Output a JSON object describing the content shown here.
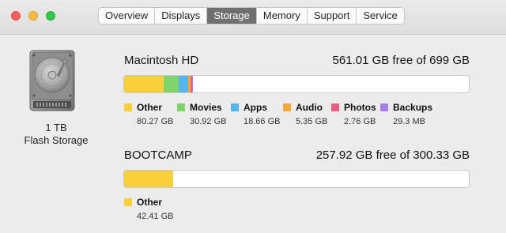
{
  "tabs": [
    "Overview",
    "Displays",
    "Storage",
    "Memory",
    "Support",
    "Service"
  ],
  "active_tab": "Storage",
  "device": {
    "capacity": "1 TB",
    "type": "Flash Storage"
  },
  "colors": {
    "other": "#f7d03c",
    "movies": "#7ed36a",
    "apps": "#56b5ef",
    "audio": "#f4a73a",
    "photos": "#ee5a86",
    "backups": "#a97ee9"
  },
  "volumes": [
    {
      "name": "Macintosh HD",
      "free": "561.01 GB free of 699 GB",
      "usage_fractions": [
        0.1148,
        0.0442,
        0.0267,
        0.0077,
        0.0039,
        0.0004
      ],
      "legend": [
        {
          "label": "Other",
          "size": "80.27 GB",
          "color": "#f7d03c"
        },
        {
          "label": "Movies",
          "size": "30.92 GB",
          "color": "#7ed36a"
        },
        {
          "label": "Apps",
          "size": "18.66 GB",
          "color": "#56b5ef"
        },
        {
          "label": "Audio",
          "size": "5.35 GB",
          "color": "#f4a73a"
        },
        {
          "label": "Photos",
          "size": "2.76 GB",
          "color": "#ee5a86"
        },
        {
          "label": "Backups",
          "size": "29.3 MB",
          "color": "#a97ee9"
        }
      ]
    },
    {
      "name": "BOOTCAMP",
      "free": "257.92 GB free of 300.33 GB",
      "usage_fractions": [
        0.1412
      ],
      "legend": [
        {
          "label": "Other",
          "size": "42.41 GB",
          "color": "#f7d03c"
        }
      ]
    }
  ]
}
